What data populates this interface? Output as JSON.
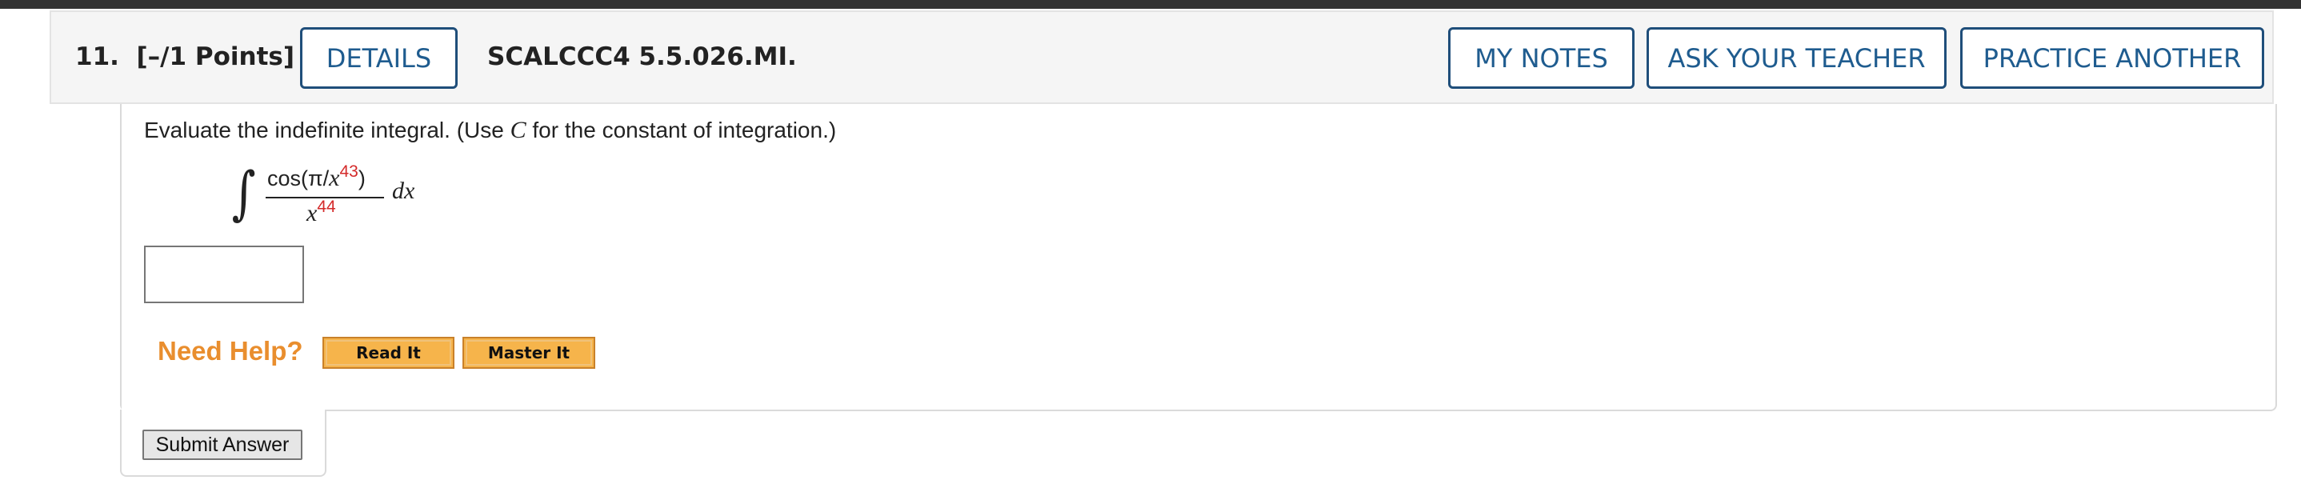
{
  "question": {
    "number": "11.",
    "points": "[–/1 Points]",
    "details_label": "DETAILS",
    "id": "SCALCCC4 5.5.026.MI."
  },
  "header_buttons": {
    "my_notes": "MY NOTES",
    "ask_teacher": "ASK YOUR TEACHER",
    "practice_another": "PRACTICE ANOTHER"
  },
  "body": {
    "instruction_prefix": "Evaluate the indefinite integral. (Use ",
    "instruction_var": "C",
    "instruction_suffix": " for the constant of integration.)",
    "integral": {
      "sign": "∫",
      "numerator_prefix": "cos(π/",
      "numerator_var": "x",
      "numerator_exp": "43",
      "numerator_suffix": ")",
      "denominator_var": "x",
      "denominator_exp": "44",
      "differential": "dx"
    },
    "answer_value": ""
  },
  "help": {
    "label": "Need Help?",
    "read_it": "Read It",
    "master_it": "Master It"
  },
  "submit_label": "Submit Answer",
  "colors": {
    "header_button_border": "#1f4e7a",
    "header_button_text": "#1f5c8f",
    "need_help_text": "#e98e2e",
    "help_button_fill": "#f6b44b",
    "exponent_red": "#d42a2a",
    "top_bar": "#333333"
  }
}
